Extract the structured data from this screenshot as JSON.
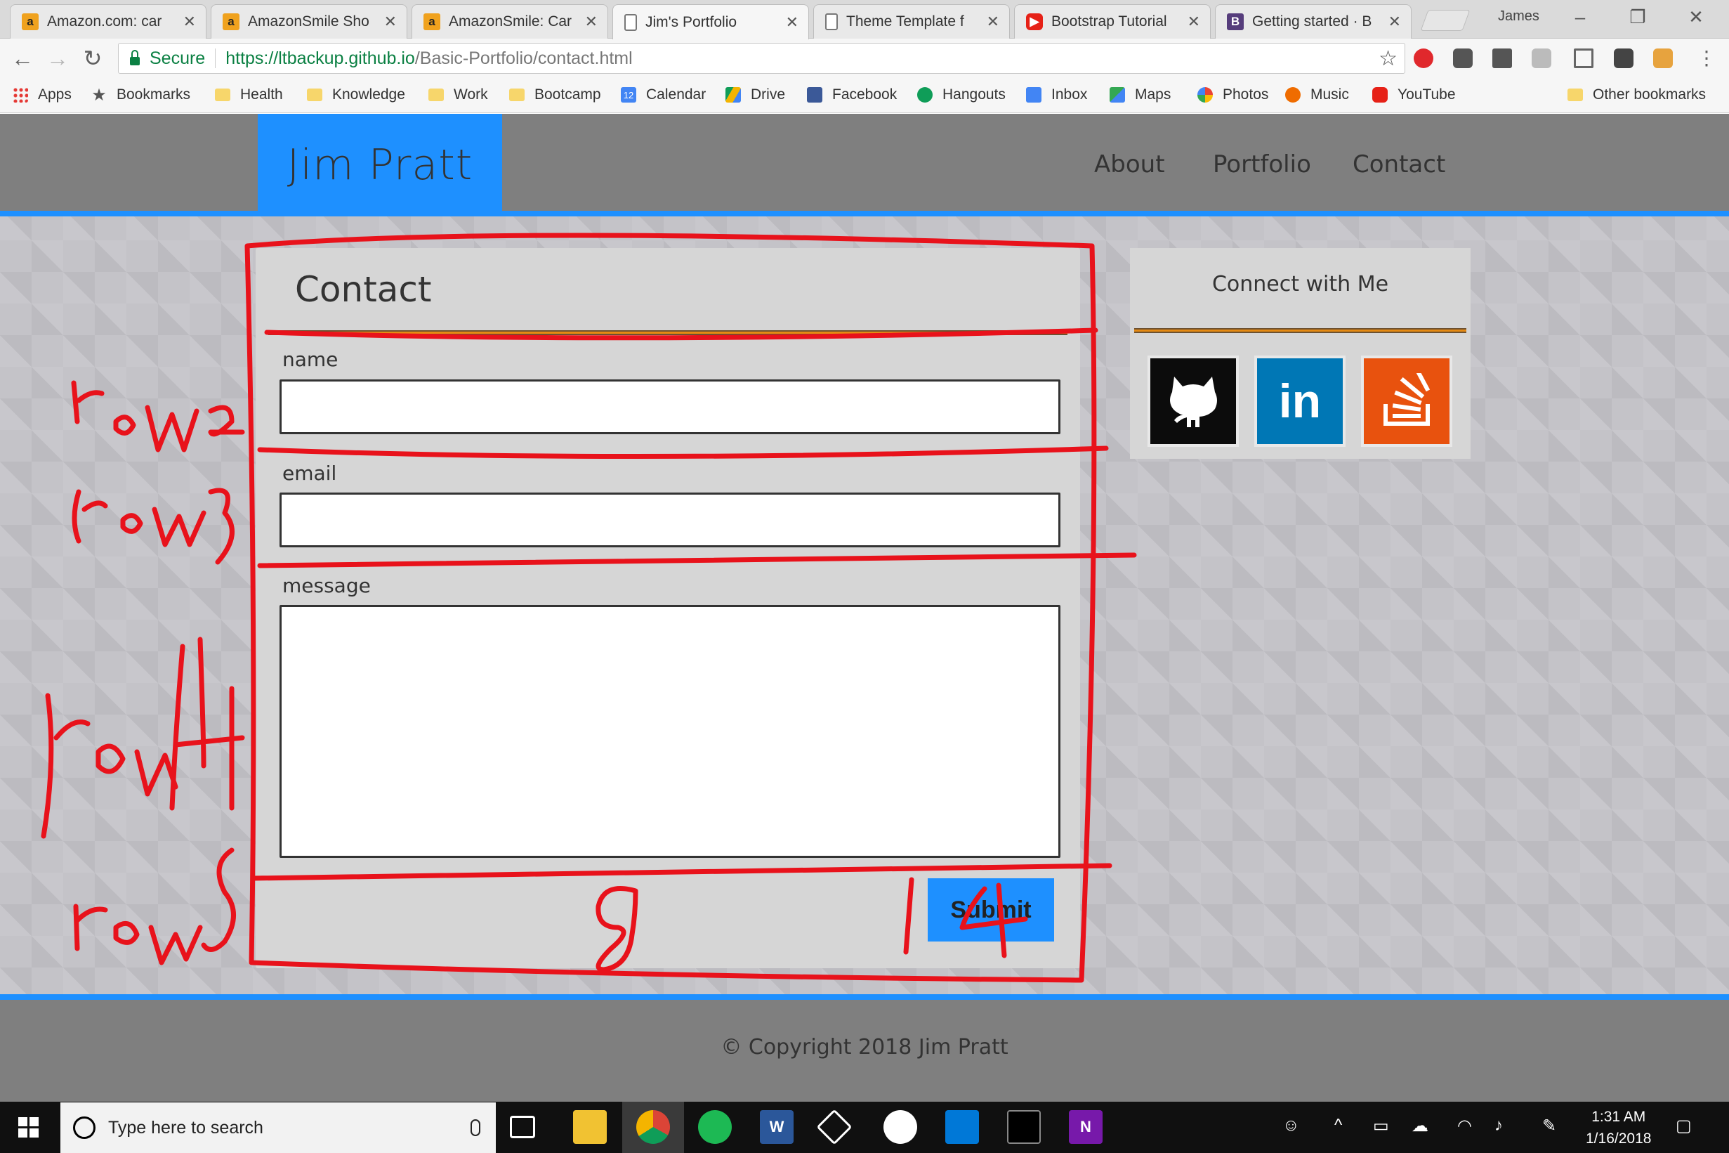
{
  "browser": {
    "tabs": [
      {
        "title": "Amazon.com: car",
        "icon": "amazon-icon"
      },
      {
        "title": "AmazonSmile Sho",
        "icon": "amazon-icon"
      },
      {
        "title": "AmazonSmile: Car",
        "icon": "amazon-icon"
      },
      {
        "title": "Jim's Portfolio",
        "icon": "page-icon",
        "active": true
      },
      {
        "title": "Theme Template f",
        "icon": "page-icon"
      },
      {
        "title": "Bootstrap Tutorial",
        "icon": "youtube-icon"
      },
      {
        "title": "Getting started · B",
        "icon": "bootstrap-icon"
      }
    ],
    "profile_name": "James",
    "secure_label": "Secure",
    "url_scheme_host": "https://ltbackup.github.io",
    "url_path": "/Basic-Portfolio/contact.html",
    "bookmarks": [
      {
        "label": "Apps",
        "icon": "apps-icon"
      },
      {
        "label": "Bookmarks",
        "icon": "star-icon"
      },
      {
        "label": "Health",
        "icon": "folder-icon"
      },
      {
        "label": "Knowledge",
        "icon": "folder-icon"
      },
      {
        "label": "Work",
        "icon": "folder-icon"
      },
      {
        "label": "Bootcamp",
        "icon": "folder-icon"
      },
      {
        "label": "Calendar",
        "icon": "calendar-icon"
      },
      {
        "label": "Drive",
        "icon": "drive-icon"
      },
      {
        "label": "Facebook",
        "icon": "facebook-icon"
      },
      {
        "label": "Hangouts",
        "icon": "hangouts-icon"
      },
      {
        "label": "Inbox",
        "icon": "inbox-icon"
      },
      {
        "label": "Maps",
        "icon": "maps-icon"
      },
      {
        "label": "Photos",
        "icon": "photos-icon"
      },
      {
        "label": "Music",
        "icon": "music-icon"
      },
      {
        "label": "YouTube",
        "icon": "youtube-icon"
      }
    ],
    "other_bookmarks": "Other bookmarks",
    "calendar_day": "12"
  },
  "site": {
    "brand": "Jim Pratt",
    "nav": [
      "About",
      "Portfolio",
      "Contact"
    ],
    "contact": {
      "title": "Contact",
      "name_label": "name",
      "email_label": "email",
      "message_label": "message",
      "submit_label": "Submit"
    },
    "social": {
      "title": "Connect with Me",
      "links": [
        "github-icon",
        "linkedin-icon",
        "stackoverflow-icon"
      ],
      "linkedin_glyph": "in"
    },
    "footer": "© Copyright 2018 Jim Pratt"
  },
  "annotations": {
    "color": "#e8121b",
    "labels": [
      "row 2",
      "row 3",
      "row 4",
      "row 5",
      "8",
      "4"
    ]
  },
  "taskbar": {
    "search_placeholder": "Type here to search",
    "word_glyph": "W",
    "onenote_glyph": "N",
    "time": "1:31 AM",
    "date": "1/16/2018"
  },
  "colors": {
    "accent_blue": "#1e90ff",
    "nav_gray": "#7f7f7f",
    "card_gray": "#d6d6d6",
    "rule_orange": "#e58a13"
  }
}
